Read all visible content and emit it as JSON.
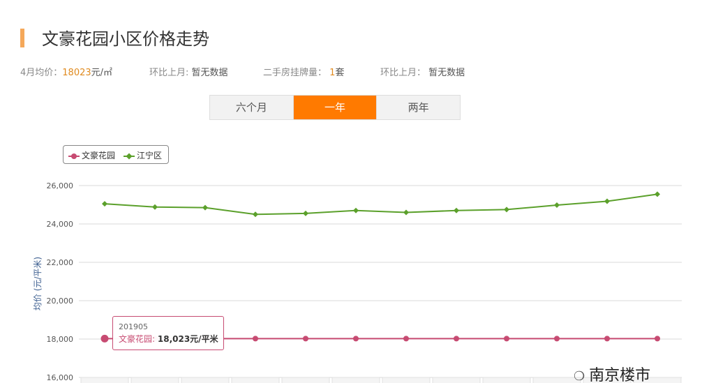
{
  "header": {
    "title": "文豪花园小区价格走势"
  },
  "stats": {
    "avg_label": "4月均价：",
    "avg_value": "18023",
    "avg_unit": "元/㎡",
    "mom1_label": "环比上月:",
    "mom1_value": "暂无数据",
    "listing_label": "二手房挂牌量：",
    "listing_value": "1",
    "listing_unit": "套",
    "mom2_label": "环比上月：",
    "mom2_value": "暂无数据"
  },
  "tabs": [
    {
      "label": "六个月",
      "active": false
    },
    {
      "label": "一年",
      "active": true
    },
    {
      "label": "两年",
      "active": false
    }
  ],
  "tooltip": {
    "x": "201905",
    "series_name": "文豪花园",
    "value": "18,023元/平米"
  },
  "watermark": {
    "icon": "wechat-icon",
    "text": "南京楼市"
  },
  "colors": {
    "accent": "#ff7a00",
    "title_bar": "#f5a85a",
    "wenhao": "#c74b72",
    "jiangning": "#5ba02b"
  },
  "chart_data": {
    "type": "line",
    "ylabel": "均价 (元/平米)",
    "ylim": [
      16000,
      26000
    ],
    "yticks": [
      "16,000",
      "18,000",
      "20,000",
      "22,000",
      "24,000",
      "26,000"
    ],
    "ytick_values": [
      16000,
      18000,
      20000,
      22000,
      24000,
      26000
    ],
    "grid": true,
    "legend_position": "top-left",
    "x": [
      "1",
      "2",
      "3",
      "4",
      "5",
      "6",
      "7",
      "8",
      "9",
      "10",
      "11",
      "12"
    ],
    "series": [
      {
        "name": "文豪花园",
        "color": "#c74b72",
        "values": [
          18023,
          18023,
          18023,
          18023,
          18023,
          18023,
          18023,
          18023,
          18023,
          18023,
          18023,
          18023
        ]
      },
      {
        "name": "江宁区",
        "color": "#5ba02b",
        "values": [
          25050,
          24880,
          24850,
          24500,
          24550,
          24700,
          24600,
          24700,
          24750,
          24980,
          25180,
          25550
        ]
      }
    ]
  }
}
